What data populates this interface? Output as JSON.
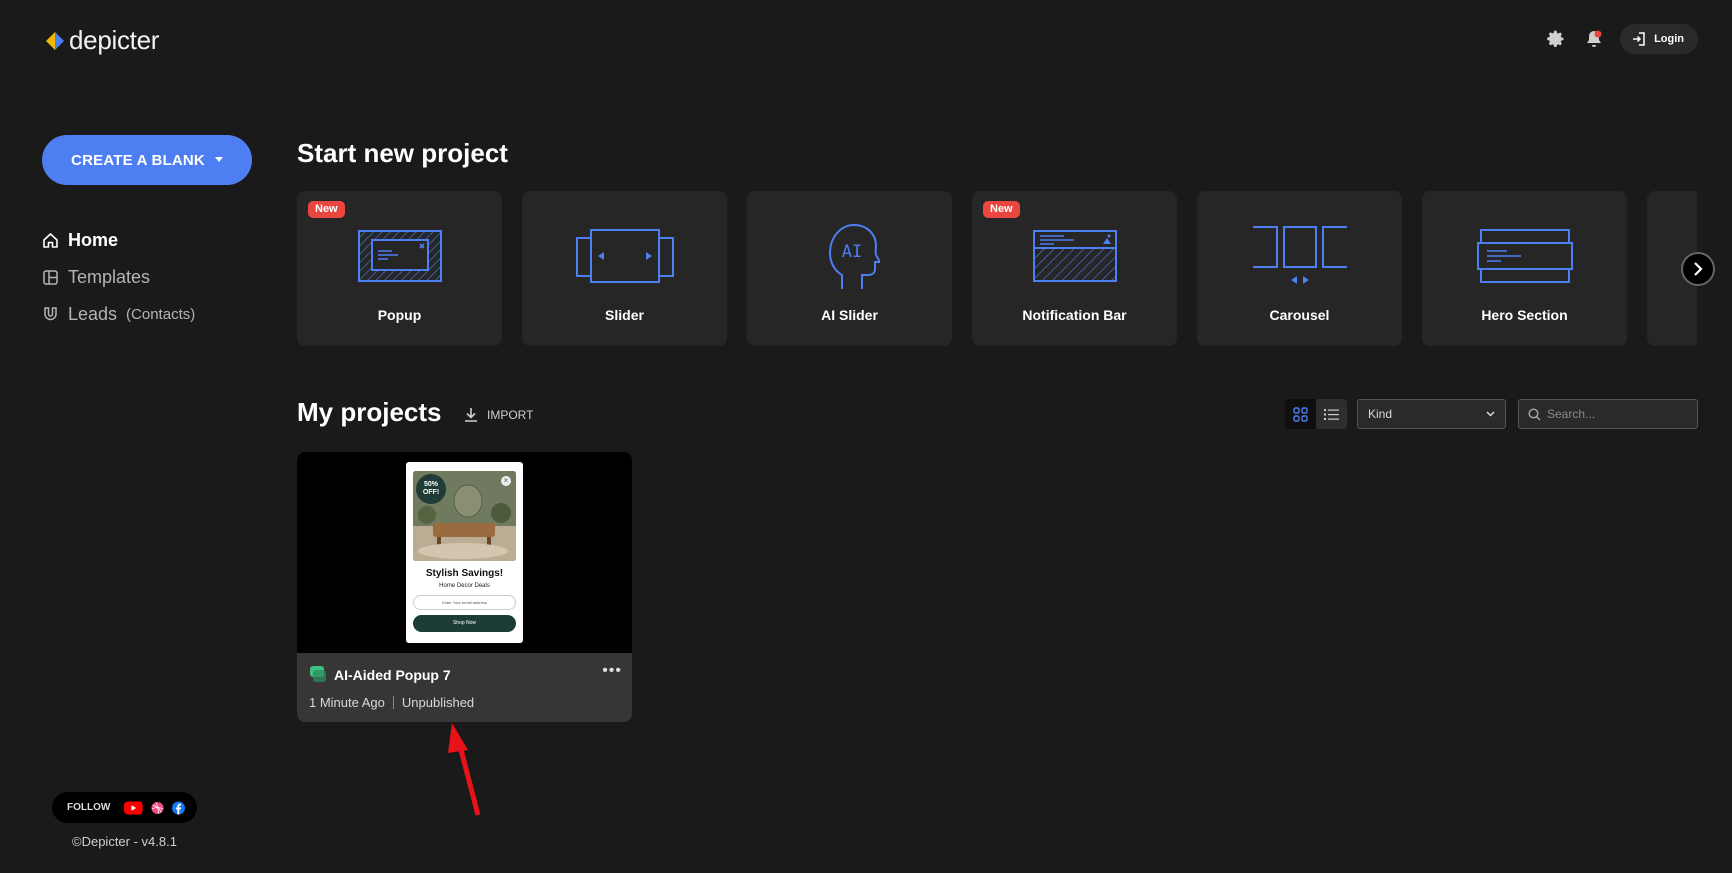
{
  "app": {
    "logo_text": "depicter"
  },
  "header": {
    "login_label": "Login"
  },
  "sidebar": {
    "create_label": "CREATE A BLANK",
    "nav": [
      {
        "label": "Home",
        "icon": "home-icon"
      },
      {
        "label": "Templates",
        "icon": "templates-icon"
      },
      {
        "label": "Leads",
        "sub": "(Contacts)",
        "icon": "leads-icon"
      }
    ],
    "follow_label": "FOLLOW",
    "copyright": "©Depicter - v4.8.1"
  },
  "start": {
    "heading": "Start new project",
    "cards": [
      {
        "label": "Popup",
        "badge": "New"
      },
      {
        "label": "Slider"
      },
      {
        "label": "AI Slider",
        "ai_text": "AI"
      },
      {
        "label": "Notification Bar",
        "badge": "New"
      },
      {
        "label": "Carousel"
      },
      {
        "label": "Hero Section"
      }
    ]
  },
  "projects": {
    "heading": "My projects",
    "import_label": "IMPORT",
    "kind_value": "Kind",
    "search_placeholder": "Search...",
    "items": [
      {
        "title": "AI-Aided Popup 7",
        "time": "1 Minute Ago",
        "status": "Unpublished",
        "preview": {
          "offer": "50% OFF!",
          "title": "Stylish Savings!",
          "subtitle": "Home Decor Deals",
          "field_placeholder": "Enter Your email address",
          "button": "Shop Now"
        }
      }
    ]
  },
  "colors": {
    "accent": "#4d7ef2",
    "badge": "#e9463f",
    "icon_blue": "#4d7ef2",
    "annotation": "#e8131a"
  }
}
